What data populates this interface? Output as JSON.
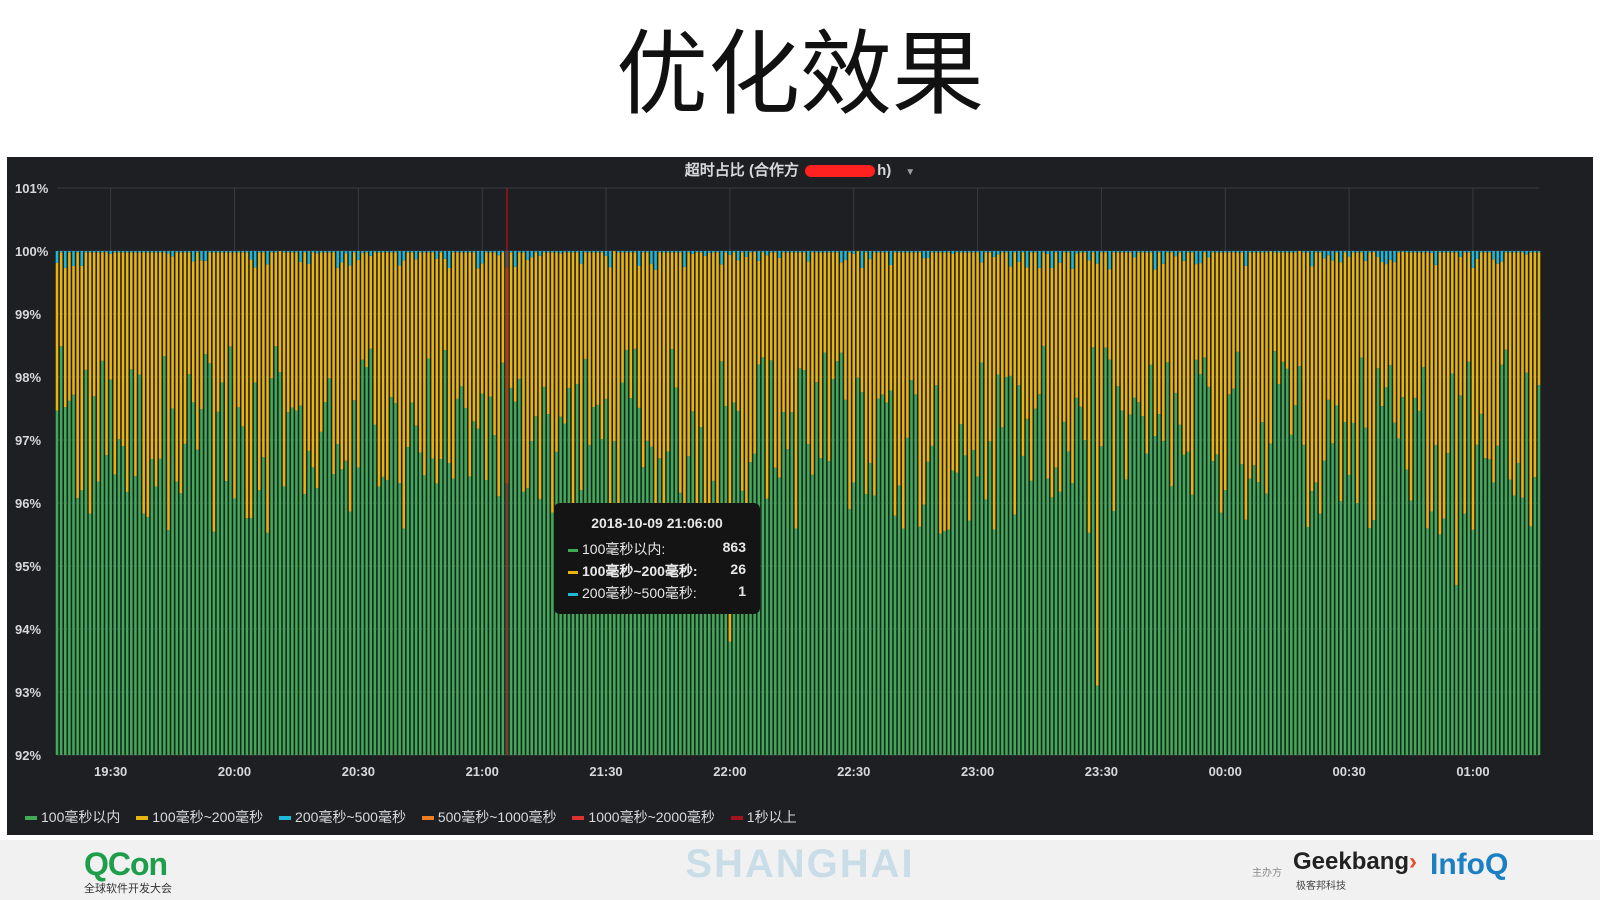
{
  "slide": {
    "title": "优化效果",
    "footer": {
      "qcon": "QCon",
      "qcon_sub": "全球软件开发大会",
      "city": "SHANGHAI",
      "host_label": "主办方",
      "geekbang": "Geekbang",
      "geekbang_sub": "极客邦科技",
      "infoq": "InfoQ"
    }
  },
  "panel": {
    "title_prefix": "超时占比 (合作方 ",
    "title_suffix": "h)",
    "tooltip": {
      "time": "2018-10-09 21:06:00",
      "rows": [
        {
          "label": "100毫秒以内:",
          "value": "863",
          "color": "#3fab56"
        },
        {
          "label": "100毫秒~200毫秒:",
          "value": "26",
          "color": "#e8b50e"
        },
        {
          "label": "200毫秒~500毫秒:",
          "value": "1",
          "color": "#1fb9d8"
        }
      ]
    }
  },
  "chart_data": {
    "type": "bar",
    "stacked": true,
    "x_ticks": [
      "19:30",
      "20:00",
      "20:30",
      "21:00",
      "21:30",
      "22:00",
      "22:30",
      "23:00",
      "23:30",
      "00:00",
      "00:30",
      "01:00"
    ],
    "x_range": [
      "19:17",
      "01:16"
    ],
    "y_ticks": [
      "92%",
      "93%",
      "94%",
      "95%",
      "96%",
      "97%",
      "98%",
      "99%",
      "100%",
      "101%"
    ],
    "ylim": [
      92,
      101
    ],
    "grid": true,
    "legend_position": "bottom-left",
    "series": [
      {
        "name": "100毫秒以内",
        "color": "#3fab56"
      },
      {
        "name": "100毫秒~200毫秒",
        "color": "#e8b50e"
      },
      {
        "name": "200毫秒~500毫秒",
        "color": "#1fb9d8"
      },
      {
        "name": "500毫秒~1000毫秒",
        "color": "#ef7f22"
      },
      {
        "name": "1000毫秒~2000毫秒",
        "color": "#e02f2f"
      },
      {
        "name": "1秒以上",
        "color": "#a1121c"
      }
    ],
    "bar_interval_minutes": 1,
    "typical_ranges_percent": {
      "100毫秒以内": [
        95.5,
        98.5
      ],
      "100毫秒~200毫秒": [
        1.5,
        4.0
      ],
      "200毫秒~500毫秒": [
        0.0,
        0.3
      ]
    },
    "notable_minima_100毫秒以内": [
      {
        "x": "22:00",
        "value": 93.8
      },
      {
        "x": "23:29",
        "value": 93.1
      },
      {
        "x": "00:56",
        "value": 94.7
      }
    ],
    "crosshair": {
      "x": "21:06",
      "color": "#a1121c"
    }
  }
}
